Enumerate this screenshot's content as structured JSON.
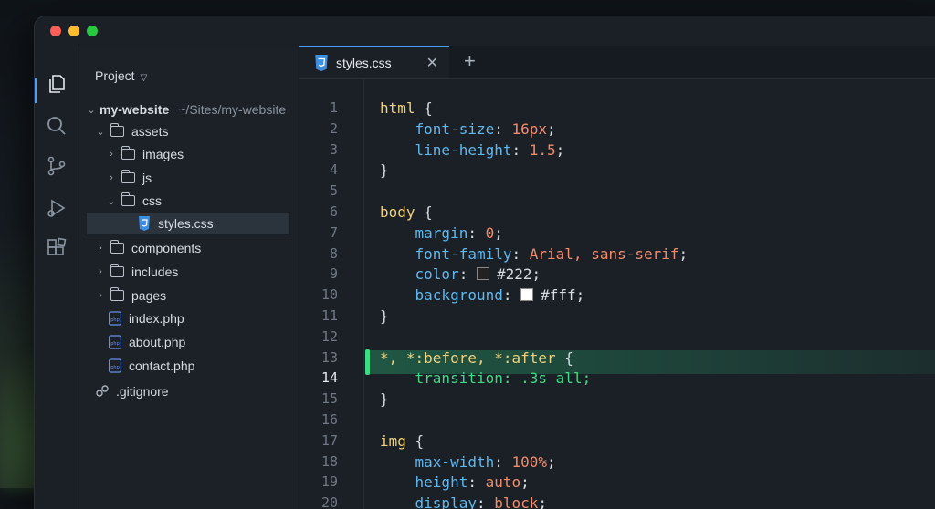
{
  "colors": {
    "accent": "#4a9eff",
    "highlight": "#3ddc84",
    "selector": "#f0d07a",
    "property": "#5fb8ee",
    "value": "#f28c6b"
  },
  "window": {
    "traffic_lights": [
      "close",
      "minimize",
      "zoom"
    ]
  },
  "activity_bar": {
    "icons": [
      "files-icon",
      "search-icon",
      "source-control-icon",
      "run-debug-icon",
      "extensions-icon"
    ]
  },
  "sidebar": {
    "title": "Project",
    "root": {
      "name": "my-website",
      "path": "~/Sites/my-website"
    },
    "items": [
      {
        "label": "assets",
        "type": "folder",
        "expanded": true
      },
      {
        "label": "images",
        "type": "folder",
        "expanded": false
      },
      {
        "label": "js",
        "type": "folder",
        "expanded": false
      },
      {
        "label": "css",
        "type": "folder",
        "expanded": true
      },
      {
        "label": "styles.css",
        "type": "css-file",
        "selected": true
      },
      {
        "label": "components",
        "type": "folder",
        "expanded": false
      },
      {
        "label": "includes",
        "type": "folder",
        "expanded": false
      },
      {
        "label": "pages",
        "type": "folder",
        "expanded": false
      },
      {
        "label": "index.php",
        "type": "php-file"
      },
      {
        "label": "about.php",
        "type": "php-file"
      },
      {
        "label": "contact.php",
        "type": "php-file"
      },
      {
        "label": ".gitignore",
        "type": "git-file"
      }
    ]
  },
  "tabs": [
    {
      "label": "styles.css",
      "active": true
    }
  ],
  "editor": {
    "active_line": 14,
    "line_numbers": [
      "1",
      "2",
      "3",
      "4",
      "5",
      "6",
      "7",
      "8",
      "9",
      "10",
      "11",
      "12",
      "13",
      "14",
      "15",
      "16",
      "17",
      "18",
      "19",
      "20"
    ],
    "lines": [
      {
        "sel": "html",
        "rest": " {"
      },
      {
        "prop": "font-size",
        "val": "16px"
      },
      {
        "prop": "line-height",
        "val": "1.5"
      },
      {
        "close": "}"
      },
      {},
      {
        "sel": "body",
        "rest": " {"
      },
      {
        "prop": "margin",
        "val": "0"
      },
      {
        "prop": "font-family",
        "val": "Arial, sans-serif"
      },
      {
        "prop": "color",
        "val": "#222",
        "swatch": "#222222"
      },
      {
        "prop": "background",
        "val": "#fff",
        "swatch": "#ffffff"
      },
      {
        "close": "}"
      },
      {},
      {
        "sel": "*, *:before, *:after",
        "rest": " {"
      },
      {
        "prop": "transition",
        "val": ".3s all"
      },
      {
        "close": "}"
      },
      {},
      {
        "sel": "img",
        "rest": " {"
      },
      {
        "prop": "max-width",
        "val": "100%"
      },
      {
        "prop": "height",
        "val": "auto"
      },
      {
        "prop": "display",
        "val": "block"
      }
    ]
  }
}
